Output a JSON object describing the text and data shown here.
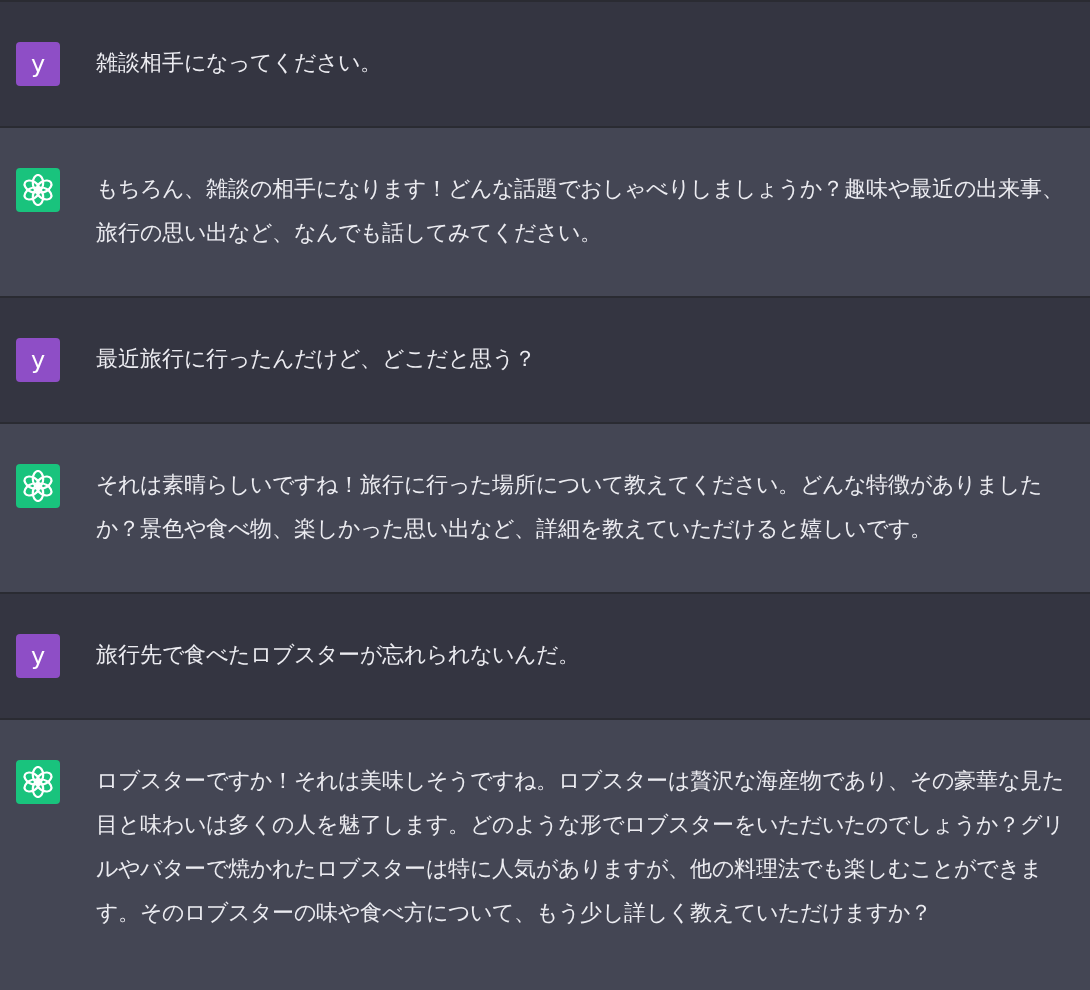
{
  "messages": [
    {
      "kind": "user",
      "avatar": "y",
      "text": "雑談相手になってください。"
    },
    {
      "kind": "assistant",
      "text": "もちろん、雑談の相手になります！どんな話題でおしゃべりしましょうか？趣味や最近の出来事、旅行の思い出など、なんでも話してみてください。"
    },
    {
      "kind": "user",
      "avatar": "y",
      "text": "最近旅行に行ったんだけど、どこだと思う？"
    },
    {
      "kind": "assistant",
      "text": "それは素晴らしいですね！旅行に行った場所について教えてください。どんな特徴がありましたか？景色や食べ物、楽しかった思い出など、詳細を教えていただけると嬉しいです。"
    },
    {
      "kind": "user",
      "avatar": "y",
      "text": "旅行先で食べたロブスターが忘れられないんだ。"
    },
    {
      "kind": "assistant",
      "text": "ロブスターですか！それは美味しそうですね。ロブスターは贅沢な海産物であり、その豪華な見た目と味わいは多くの人を魅了します。どのような形でロブスターをいただいたのでしょうか？グリルやバターで焼かれたロブスターは特に人気がありますが、他の料理法でも楽しむことができます。そのロブスターの味や食べ方について、もう少し詳しく教えていただけますか？"
    }
  ]
}
